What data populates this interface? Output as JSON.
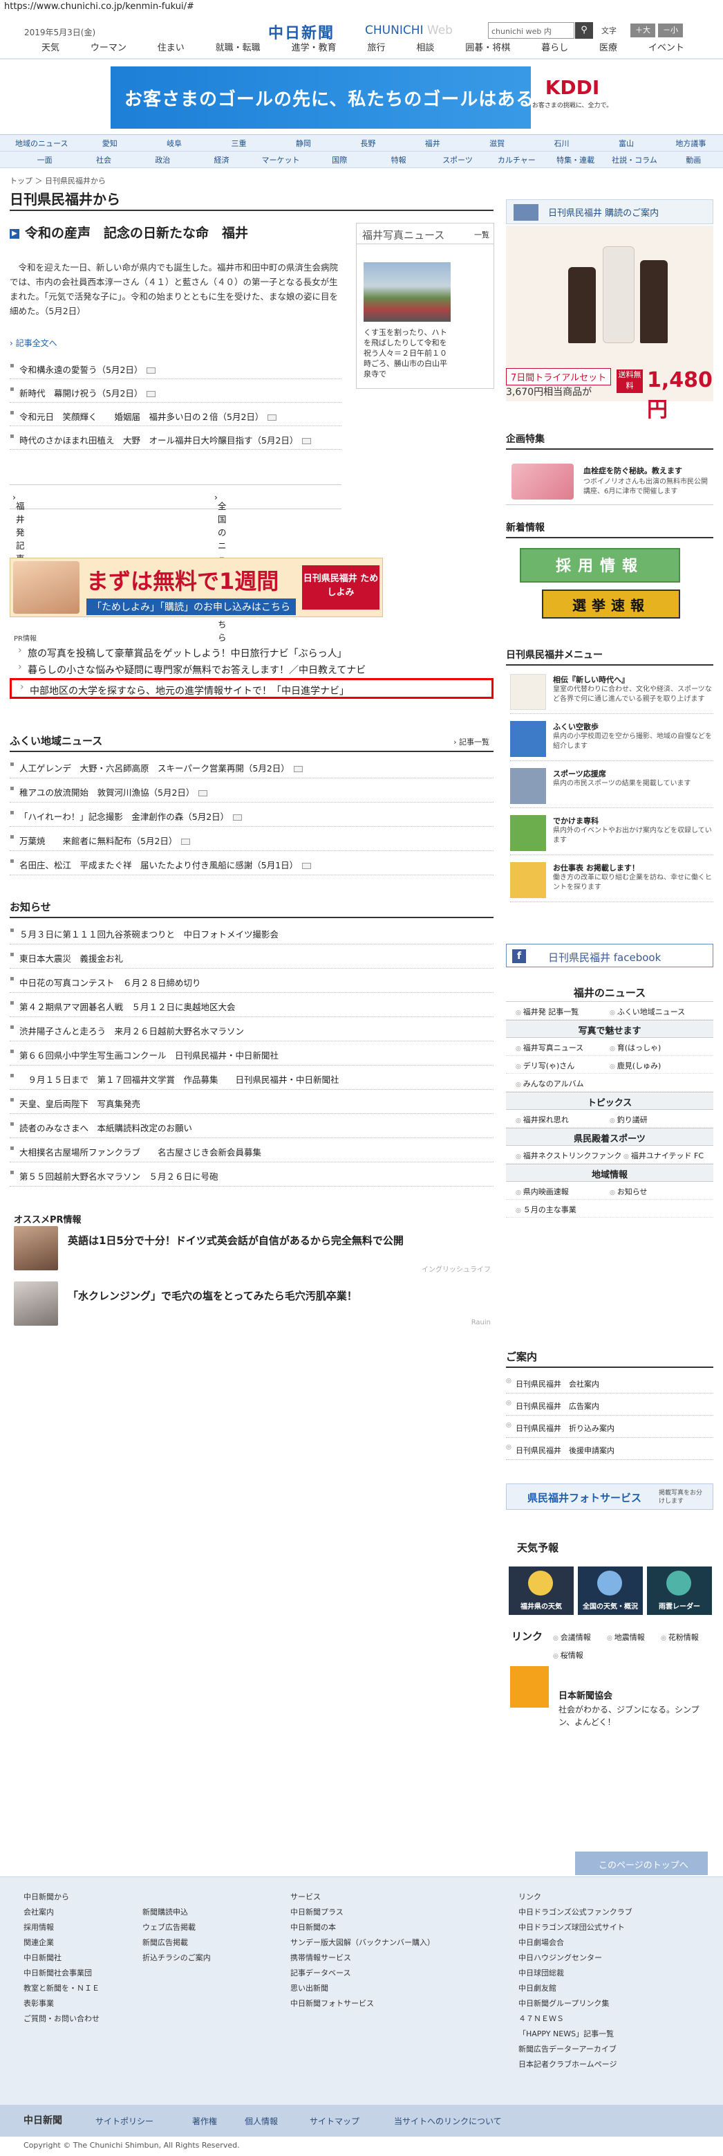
{
  "url": "https://www.chunichi.co.jp/kenmin-fukui/#",
  "header": {
    "date": "2019年5月3日(金)",
    "logo": "中日新聞",
    "logo_sub_1": "CHUNICHI",
    "logo_sub_2": "Web",
    "search_placeholder": "chunichi web 内",
    "search_icon": "search-icon",
    "fontsize_label": "文字",
    "fontsize_large": "＋大",
    "fontsize_small": "－小"
  },
  "topnav": [
    "天気",
    "ウーマン",
    "住まい",
    "就職・転職",
    "進学・教育",
    "旅行",
    "相談",
    "囲碁・将棋",
    "暮らし",
    "医療",
    "イベント"
  ],
  "ad_banner": {
    "text": "お客さまのゴールの先に、私たちのゴールはある。",
    "brand": "KDDI",
    "brand_sub": "お客さまの挑戦に、全力で。"
  },
  "secnav": {
    "row1": [
      "地域のニュース",
      "愛知",
      "岐阜",
      "三重",
      "静岡",
      "長野",
      "福井",
      "滋賀",
      "石川",
      "富山",
      "地方議事"
    ],
    "row2": [
      "一面",
      "社会",
      "政治",
      "経済",
      "マーケット",
      "国際",
      "特報",
      "スポーツ",
      "カルチャー",
      "特集・連載",
      "社説・コラム",
      "動画"
    ]
  },
  "breadcrumb": "トップ ＞ 日刊県民福井から",
  "page_title": "日刊県民福井から",
  "top_story": {
    "headline": "令和の産声　記念の日新たな命　福井",
    "lead": "　令和を迎えた一日、新しい命が県内でも誕生した。福井市和田中町の県済生会病院では、市内の会社員西本淳一さん（４１）と藍さん（４０）の第一子となる長女が生まれた。「元気で活発な子に」。令和の始まりとともに生を受けた、まな娘の姿に目を細めた。（5月2日）",
    "more": "記事全文へ"
  },
  "photo_news": {
    "title": "福井写真ニュース",
    "more": "一覧",
    "caption": "くす玉を割ったり、ハトを飛ばしたりして令和を祝う人々＝２日午前１０時ごろ、勝山市の白山平泉寺で"
  },
  "news_items": [
    "令和構永遠の愛誓う（5月2日）",
    "新時代　幕開け祝う（5月2日）",
    "令和元日　笑顔輝く　　婚姻届　福井多い日の２倍（5月2日）",
    "時代のさかほまれ田植え　大野　オール福井日大吟醸目指す（5月2日）"
  ],
  "list_links": {
    "left": "福井発 記事一覧",
    "right": "全国のニュースはこちら"
  },
  "promo": {
    "main": "まずは無料で1週間",
    "sub": "「ためしよみ」「購読」のお申し込みはこちら",
    "brand": "日刊県民福井 ためしよみ"
  },
  "pr": {
    "label": "PR情報",
    "items": [
      "旅の写真を投稿して豪華賞品をゲットしよう！中日旅行ナビ「ぶらっ人」",
      "暮らしの小さな悩みや疑問に専門家が無料でお答えします！／中日教えてナビ",
      "中部地区の大学を探すなら、地元の進学情報サイトで！「中日進学ナビ」"
    ]
  },
  "local_news": {
    "title": "ふくい地域ニュース",
    "more": "記事一覧",
    "items": [
      "人工ゲレンデ　大野・六呂師高原　スキーパーク営業再開（5月2日）",
      "稚アユの放流開始　敦賀河川漁協（5月2日）",
      "「ハイれーわ！」記念撮影　金津創作の森（5月2日）",
      "万葉焼　　来館者に無料配布（5月2日）",
      "名田庄、松江　平成またぐ祥　届いたたより付き風船に感謝（5月1日）"
    ]
  },
  "notice": {
    "title": "お知らせ",
    "items": [
      "５月３日に第１１１回九谷茶碗まつりと　中日フォトメイツ撮影会",
      "東日本大震災　義援金お礼",
      "中日花の写真コンテスト　６月２８日締め切り",
      "第４２期県アマ囲碁名人戦　５月１２日に奥越地区大会",
      "渋井陽子さんと走ろう　来月２６日越前大野名水マラソン",
      "第６６回県小中学生写生画コンクール　日刊県民福井・中日新聞社",
      "　９月１５日まで　第１７回福井文学賞　作品募集　　日刊県民福井・中日新聞社",
      "天皇、皇后両陛下　写真集発売",
      "読者のみなさまへ　本紙購読料改定のお願い",
      "大相撲名古屋場所ファンクラブ　　名古屋さじき会新会員募集",
      "第５５回越前大野名水マラソン　５月２６日に号砲"
    ]
  },
  "reco": {
    "title": "オススメPR情報",
    "items": [
      {
        "text": "英語は1日5分で十分！ドイツ式英会話が自信があるから完全無料で公開",
        "source": "イングリッシュライフ"
      },
      {
        "text": "「水クレンジング」で毛穴の塩をとってみたら毛穴汚肌卒業！",
        "source": "Rauin"
      }
    ]
  },
  "sidebar": {
    "kodoku": "日刊県民福井 購読のご案内",
    "product": {
      "badge": "7日間トライアルセット",
      "price_small": "3,670円相当商品が",
      "badge2": "送料無料",
      "price_large": "1,480円"
    },
    "kikaku_title": "企画特集",
    "kikaku_t1": "血栓症を防ぐ秘訣。教えます",
    "kikaku_t2": "つボイノリオさんも出演の無料市民公開講座、6月に津市で開催します",
    "shinchaku_title": "新着情報",
    "saiyo": "採用情報",
    "senkyo": "選挙速報",
    "menu_title": "日刊県民福井メニュー",
    "menu": [
      {
        "t": "相伝『新しい時代へ』",
        "d": "皇室の代替わりに合わせ、文化や経済、スポーツなど各界で何に通じ進んでいる親子を取り上げます"
      },
      {
        "t": "ふくい空散歩",
        "d": "県内の小学校周辺を空から撮影、地域の自慢などを紹介します"
      },
      {
        "t": "スポーツ応援席",
        "d": "県内の市民スポーツの結果を掲載しています"
      },
      {
        "t": "でかけま専科",
        "d": "県内外のイベントやお出かけ案内などを収録しています"
      },
      {
        "t": "お仕事表 お掲載します！",
        "d": "働き方の改革に取り組む企業を訪ね、幸せに働くヒントを探ります"
      }
    ],
    "facebook": "日刊県民福井 facebook",
    "fukui_news": "福井のニュース",
    "fn_r1": [
      "福井発 記事一覧",
      "ふくい地域ニュース"
    ],
    "fn_sub1": "写真で魅せます",
    "fn_r2": [
      "福井写真ニュース",
      "育(はっしゃ)"
    ],
    "fn_r3": [
      "デリ写(ゃ)さん",
      "鹿見(しゅみ)"
    ],
    "fn_r4": [
      "みんなのアルバム"
    ],
    "fn_sub2": "トピックス",
    "fn_r5": [
      "福井探れ思れ",
      "釣り議研"
    ],
    "fn_sub3": "県民殿着スポーツ",
    "fn_r6": [
      "福井ネクストリンクファンク",
      "福井ユナイテッド FC"
    ],
    "fn_sub4": "地域情報",
    "fn_r7": [
      "県内映画速報",
      "お知らせ"
    ],
    "fn_r8": [
      "５月の主な事業"
    ],
    "goannai_title": "ご案内",
    "goannai": [
      "日刊県民福井　会社案内",
      "日刊県民福井　広告案内",
      "日刊県民福井　折り込み案内",
      "日刊県民福井　後援申請案内"
    ],
    "photosvc": "県民福井フォトサービス",
    "photosvc_sub": "掲載写真をお分けします",
    "weather_title": "天気予報",
    "weather": [
      "福井県の天気",
      "全国の天気・概況",
      "雨雲レーダー"
    ],
    "link_title": "リンク",
    "links": [
      "会議情報",
      "地震情報",
      "花粉情報",
      "桜情報"
    ],
    "jp_title": "日本新聞協会",
    "jp_desc": "社会がわかる、ジブンになる。シンプン、よんどく！"
  },
  "pagetop": "このページのトップへ",
  "footer": {
    "col1_head": "中日新聞から",
    "col1": [
      "会社案内",
      "採用情報",
      "関連企業",
      "中日新聞社",
      "中日新聞社会事業団",
      "教室と新聞を・ＮＩＥ",
      "表彰事業",
      "ご質問・お問い合わせ"
    ],
    "col2": [
      "新聞購読申込",
      "ウェブ広告掲載",
      "新聞広告掲載",
      "折込チラシのご案内"
    ],
    "col3_head": "サービス",
    "col3": [
      "中日新聞プラス",
      "中日新聞の本",
      "サンデー版大図解（バックナンバー購入）",
      "携帯情報サービス",
      "記事データベース",
      "思い出新聞",
      "中日新聞フォトサービス"
    ],
    "col4_head": "リンク",
    "col4": [
      "中日ドラゴンズ公式ファンクラブ",
      "中日ドラゴンズ球団公式サイト",
      "中日劇場会合",
      "中日ハウジングセンター",
      "中日球団総裁",
      "中日劇友館",
      "中日新聞グループリンク集",
      "４７ＮＥＷＳ",
      "「HAPPY NEWS」記事一覧",
      "新聞広告データーアーカイブ",
      "日本記者クラブホームページ"
    ],
    "bar_logo": "中日新聞",
    "bar": [
      "サイトポリシー",
      "著作権",
      "個人情報",
      "サイトマップ",
      "当サイトへのリンクについて"
    ],
    "copyright": "Copyright © The Chunichi Shimbun, All Rights Reserved."
  }
}
